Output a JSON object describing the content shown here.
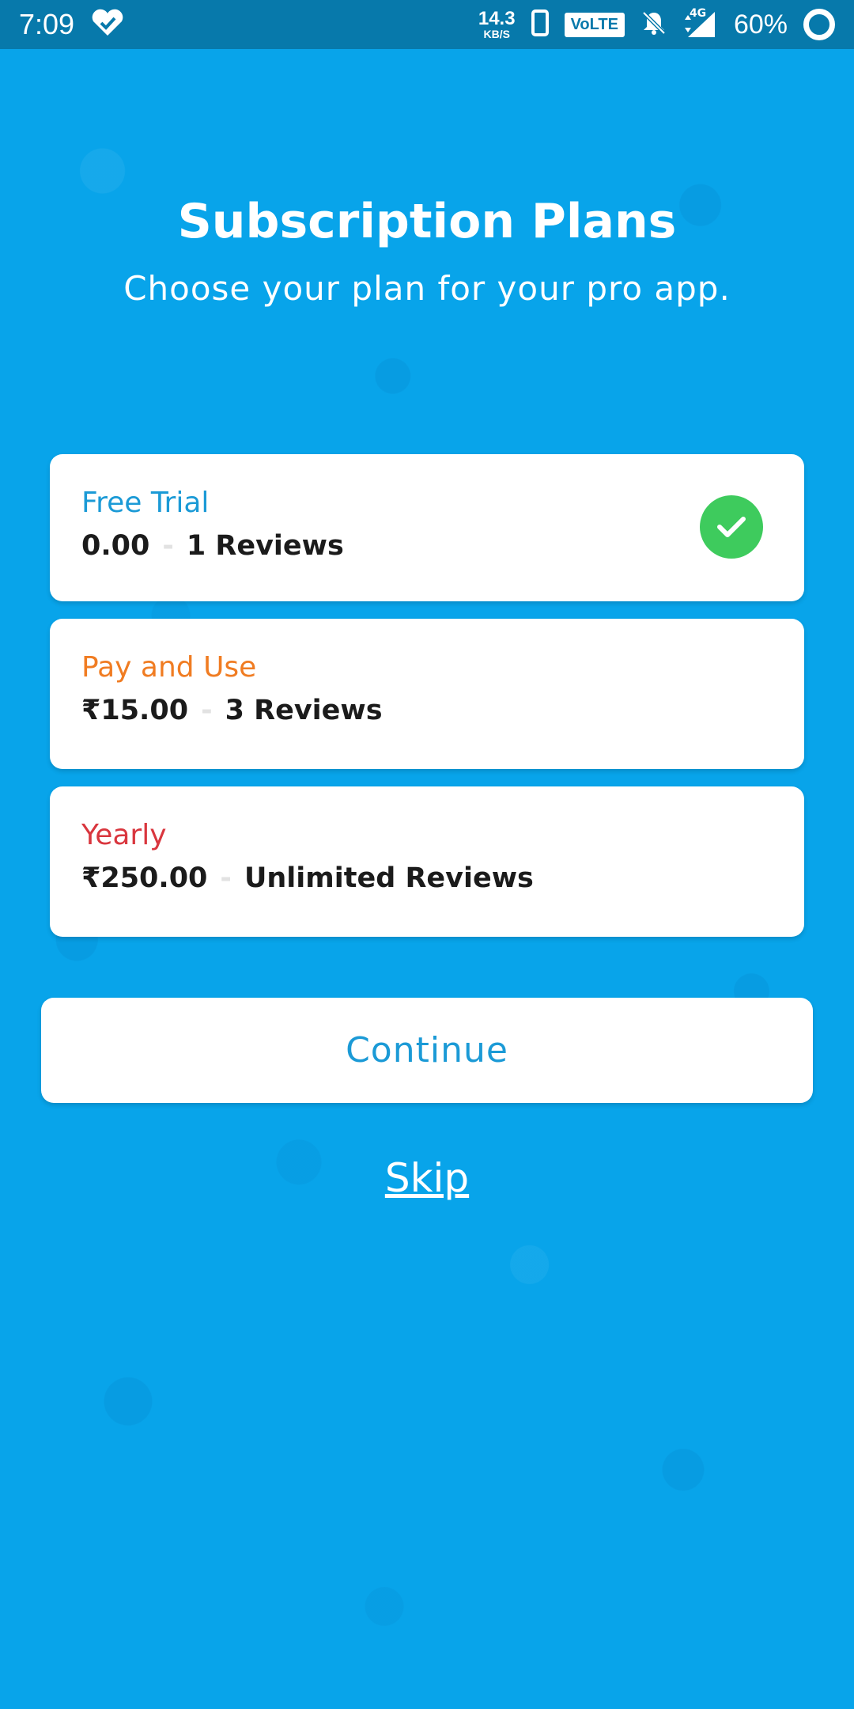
{
  "status_bar": {
    "time": "7:09",
    "speed_value": "14.3",
    "speed_unit": "KB/S",
    "volte": "VoLTE",
    "network": "4G",
    "battery": "60%"
  },
  "header": {
    "title": "Subscription Plans",
    "subtitle": "Choose your plan for your pro app."
  },
  "plans": [
    {
      "name": "Free Trial",
      "price": "0.00",
      "reviews": "1 Reviews",
      "color": "#1b9ad6",
      "selected": true
    },
    {
      "name": "Pay and Use",
      "price": "₹15.00",
      "reviews": "3 Reviews",
      "color": "#f07c22",
      "selected": false
    },
    {
      "name": "Yearly",
      "price": "₹250.00",
      "reviews": "Unlimited Reviews",
      "color": "#d9363e",
      "selected": false
    }
  ],
  "actions": {
    "continue_label": "Continue",
    "skip_label": "Skip"
  },
  "colors": {
    "background": "#08a4ea",
    "status_bar": "#0779ab",
    "selected_check": "#3ecb5d"
  }
}
